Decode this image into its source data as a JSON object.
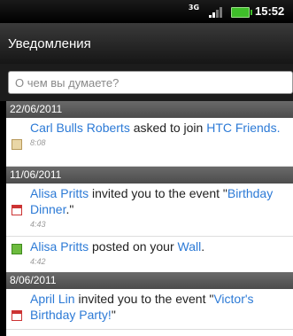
{
  "status_bar": {
    "network": "3G",
    "time": "15:52",
    "battery_color": "#3fbf2a"
  },
  "header": {
    "title": "Уведомления"
  },
  "search": {
    "placeholder": "О чем вы думаете?"
  },
  "sections": [
    {
      "date": "22/06/2011",
      "items": [
        {
          "icon": "friend-request-icon",
          "name": "Carl Bulls Roberts",
          "action": " asked to join ",
          "target": "HTC Friends.",
          "time": "8:08"
        }
      ]
    },
    {
      "date": "11/06/2011",
      "items": [
        {
          "icon": "event-icon",
          "name": "Alisa Pritts",
          "action": " invited you to the event \"",
          "target": "Birthday Dinner",
          "suffix": ".\"",
          "time": "4:43"
        },
        {
          "icon": "wall-post-icon",
          "name": "Alisa Pritts",
          "action": " posted on your ",
          "target": "Wall",
          "suffix": ".",
          "time": "4:42"
        }
      ]
    },
    {
      "date": "8/06/2011",
      "items": [
        {
          "icon": "event-icon",
          "name": "April Lin",
          "action": " invited you to the event \"",
          "target": "Victor's Birthday Party!",
          "suffix": "\""
        }
      ]
    }
  ],
  "colors": {
    "link": "#2c7ad6",
    "date_header": "#5a5a5a"
  }
}
